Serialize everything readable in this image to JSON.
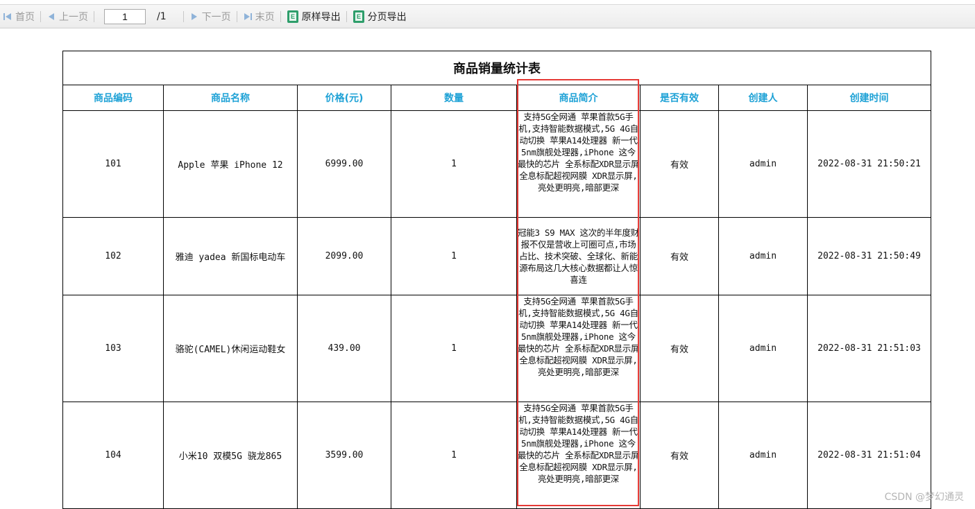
{
  "toolbar": {
    "first_label": "首页",
    "prev_label": "上一页",
    "page_value": "1",
    "page_total": "/1",
    "next_label": "下一页",
    "last_label": "末页",
    "export_original_label": "原样导出",
    "export_paged_label": "分页导出"
  },
  "report": {
    "title": "商品销量统计表",
    "columns": [
      "商品编码",
      "商品名称",
      "价格(元)",
      "数量",
      "商品简介",
      "是否有效",
      "创建人",
      "创建时间"
    ],
    "rows": [
      {
        "code": "101",
        "name": "Apple 苹果 iPhone 12",
        "price": "6999.00",
        "qty": "1",
        "desc": "支持5G全网通 苹果首款5G手机,支持智能数据模式,5G 4G自动切换 苹果A14处理器 新一代5nm旗舰处理器,iPhone 这今最快的芯片 全系标配XDR显示屏 全息标配超视网膜 XDR显示屏,亮处更明亮,暗部更深",
        "valid": "有效",
        "creator": "admin",
        "created": "2022-08-31 21:50:21"
      },
      {
        "code": "102",
        "name": "雅迪 yadea 新国标电动车",
        "price": "2099.00",
        "qty": "1",
        "desc": "冠能3 S9 MAX 这次的半年度财报不仅是营收上可圈可点,市场占比、技术突破、全球化、新能源布局这几大核心数据都让人惊喜连",
        "valid": "有效",
        "creator": "admin",
        "created": "2022-08-31 21:50:49"
      },
      {
        "code": "103",
        "name": "骆驼(CAMEL)休闲运动鞋女",
        "price": "439.00",
        "qty": "1",
        "desc": "支持5G全网通 苹果首款5G手机,支持智能数据模式,5G 4G自动切换 苹果A14处理器 新一代5nm旗舰处理器,iPhone 这今最快的芯片 全系标配XDR显示屏 全息标配超视网膜 XDR显示屏,亮处更明亮,暗部更深",
        "valid": "有效",
        "creator": "admin",
        "created": "2022-08-31 21:51:03"
      },
      {
        "code": "104",
        "name": "小米10 双模5G 骁龙865",
        "price": "3599.00",
        "qty": "1",
        "desc": "支持5G全网通 苹果首款5G手机,支持智能数据模式,5G 4G自动切换 苹果A14处理器 新一代5nm旗舰处理器,iPhone 这今最快的芯片 全系标配XDR显示屏 全息标配超视网膜 XDR显示屏,亮处更明亮,暗部更深",
        "valid": "有效",
        "creator": "admin",
        "created": "2022-08-31 21:51:04"
      }
    ]
  },
  "watermark": "CSDN @梦幻通灵",
  "colors": {
    "header_text": "#1fa2d6",
    "highlight_border": "#e53935",
    "nav_disabled": "#9a9a9a",
    "export_icon": "#2e9e6b"
  }
}
